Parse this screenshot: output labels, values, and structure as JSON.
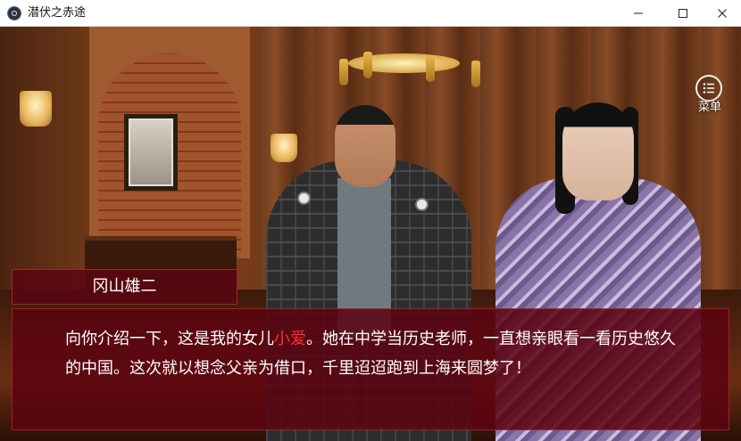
{
  "window": {
    "title": "潜伏之赤途",
    "minimize_glyph": "─",
    "maximize_glyph": "☐",
    "close_glyph": "✕"
  },
  "menu": {
    "icon": "menu-list-icon",
    "label": "菜单"
  },
  "dialogue": {
    "speaker": "冈山雄二",
    "text_before": "向你介绍一下，这是我的女儿",
    "highlight": "小爱",
    "text_after": "。她在中学当历史老师，一直想亲眼看一看历史悠久的中国。这次就以想念父亲为借口，千里迢迢跑到上海来圆梦了！",
    "highlight_color": "#ff3030"
  },
  "colors": {
    "dialog_bg": "#5c0410",
    "text": "#ffffff"
  }
}
